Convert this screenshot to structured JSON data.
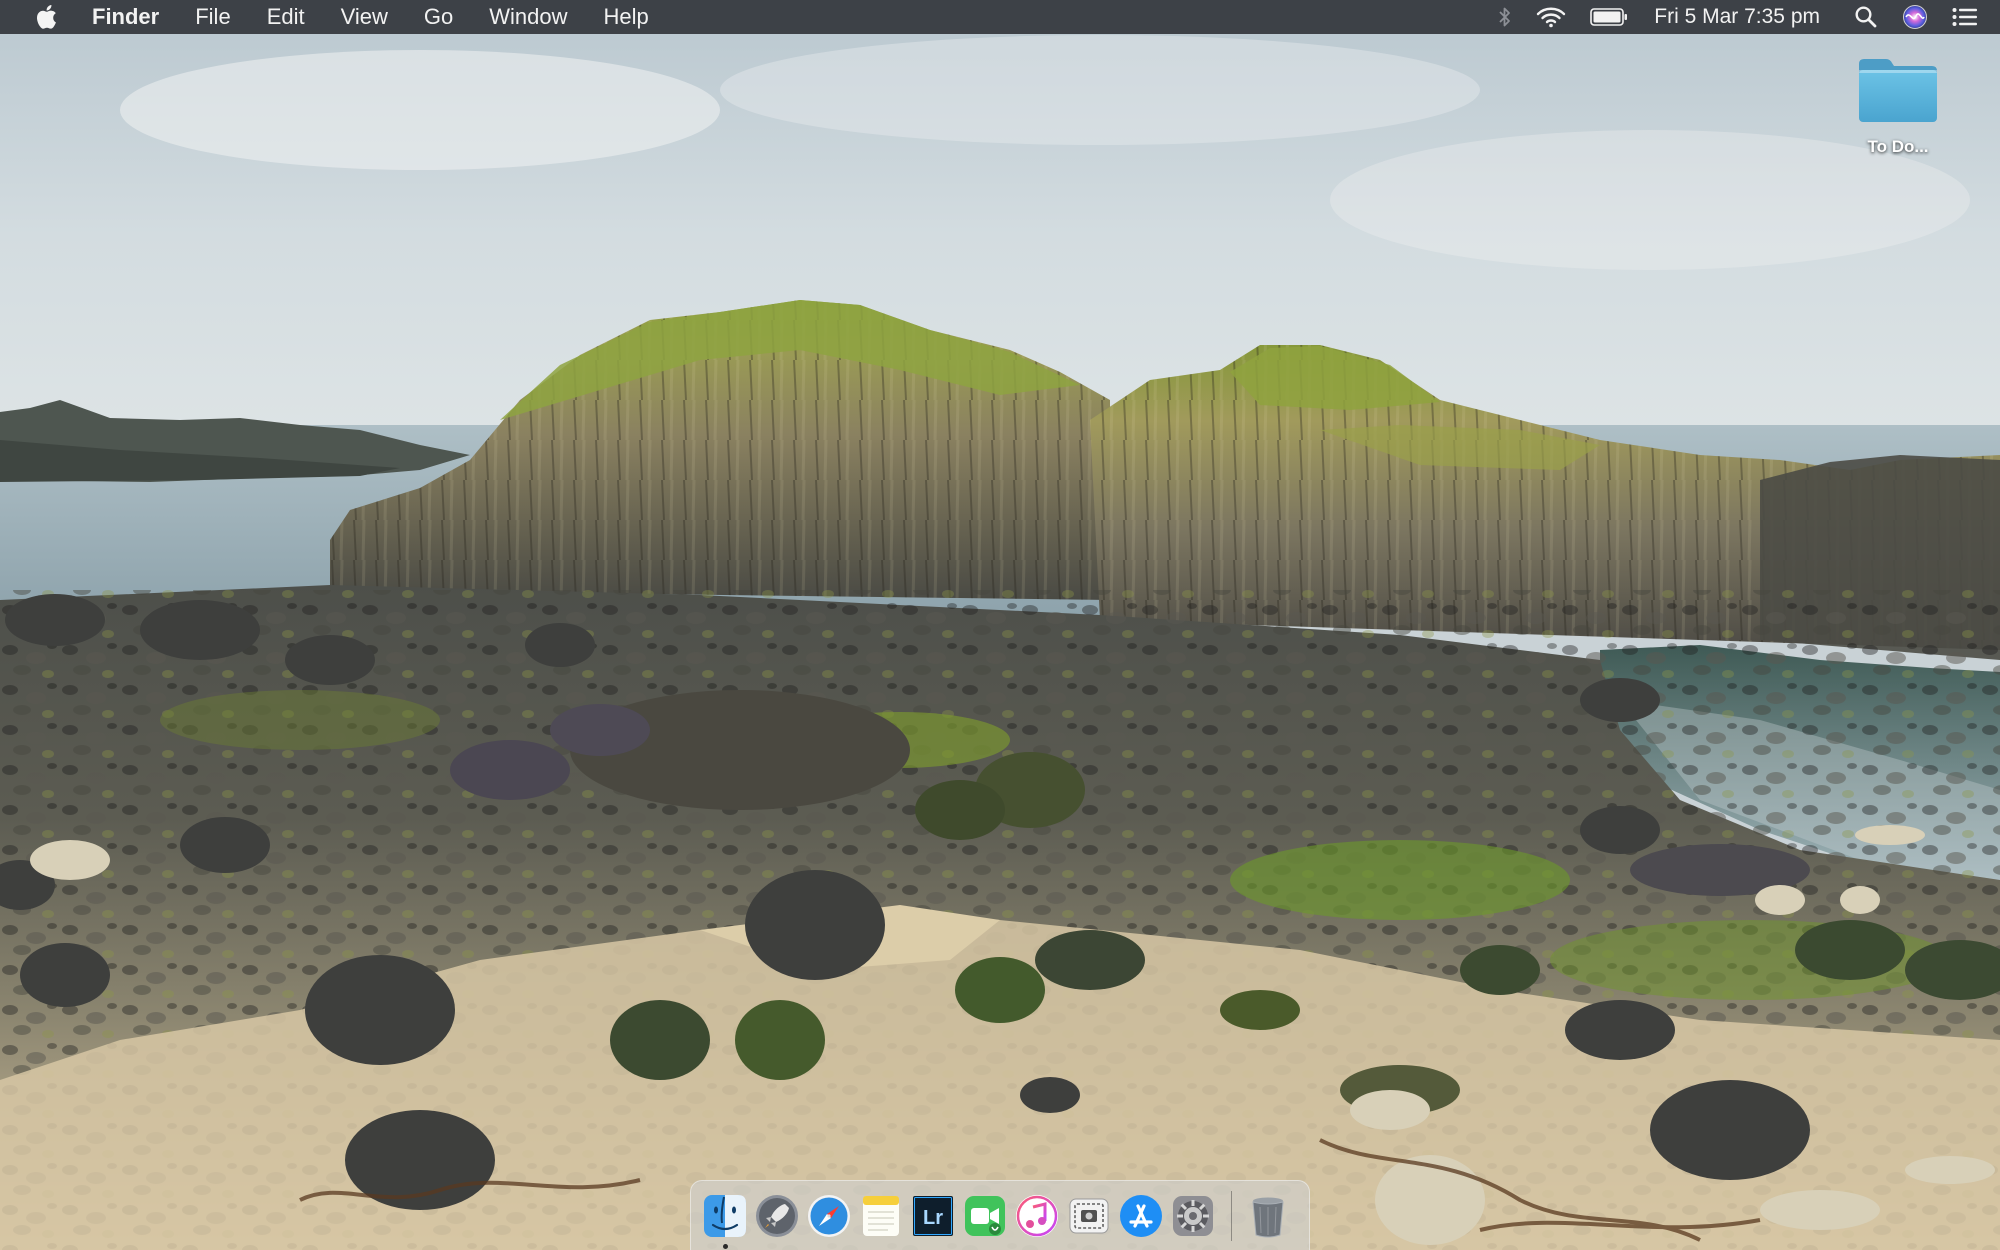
{
  "menubar": {
    "app_name": "Finder",
    "menus": [
      "File",
      "Edit",
      "View",
      "Go",
      "Window",
      "Help"
    ],
    "clock": "Fri 5 Mar  7:35 pm",
    "status_icons": [
      "bluetooth-icon",
      "wifi-icon",
      "battery-icon",
      "spotlight-search-icon",
      "siri-icon",
      "notification-center-icon"
    ]
  },
  "desktop": {
    "items": [
      {
        "label": "To Do...",
        "icon": "folder-icon"
      }
    ]
  },
  "dock": {
    "apps": [
      {
        "name": "Finder",
        "icon": "finder-icon",
        "running": true
      },
      {
        "name": "Launchpad",
        "icon": "launchpad-icon",
        "running": false
      },
      {
        "name": "Safari",
        "icon": "safari-icon",
        "running": false
      },
      {
        "name": "Notes",
        "icon": "notes-icon",
        "running": false
      },
      {
        "name": "Lightroom",
        "icon": "lightroom-icon",
        "running": false,
        "label": "Lr"
      },
      {
        "name": "FaceTime",
        "icon": "facetime-icon",
        "running": false
      },
      {
        "name": "iTunes",
        "icon": "itunes-icon",
        "running": false
      },
      {
        "name": "Screenshot",
        "icon": "screenshot-icon",
        "running": false
      },
      {
        "name": "App Store",
        "icon": "app-store-icon",
        "running": false
      },
      {
        "name": "System Preferences",
        "icon": "system-preferences-icon",
        "running": false
      },
      {
        "name": "Trash",
        "icon": "trash-icon",
        "running": false
      }
    ]
  },
  "colors": {
    "menubar_bg": "#34373c",
    "folder_blue": "#5ab2d8",
    "sky": "#cfd8dd",
    "sea": "#9fb3bc",
    "sand": "#d8c7a5",
    "rock": "#4c4c48",
    "moss": "#8a9a3c"
  }
}
